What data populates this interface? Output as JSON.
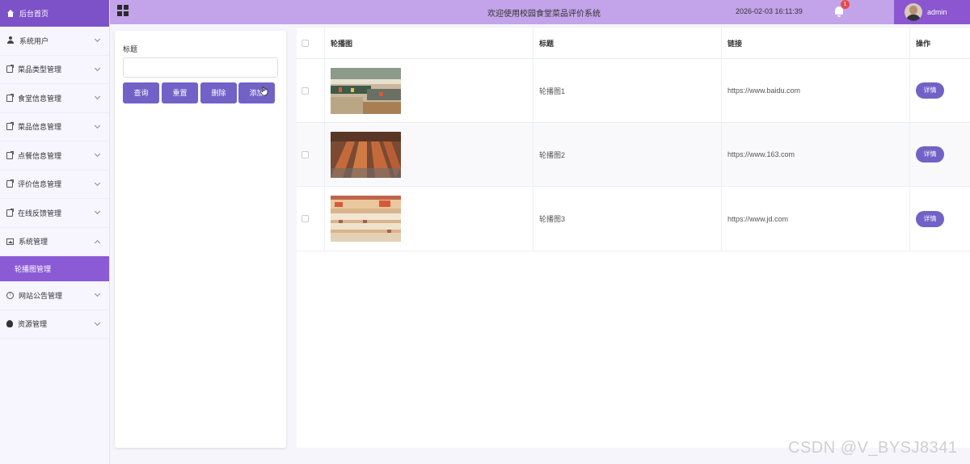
{
  "sidebar": {
    "home": "后台首页",
    "items": [
      {
        "label": "系统用户",
        "icon": "user-icon"
      },
      {
        "label": "菜品类型管理",
        "icon": "document-icon"
      },
      {
        "label": "食堂信息管理",
        "icon": "document-icon"
      },
      {
        "label": "菜品信息管理",
        "icon": "document-icon"
      },
      {
        "label": "点餐信息管理",
        "icon": "document-icon"
      },
      {
        "label": "评价信息管理",
        "icon": "document-icon"
      },
      {
        "label": "在线反馈管理",
        "icon": "document-icon"
      },
      {
        "label": "系统管理",
        "icon": "image-icon"
      }
    ],
    "active_sub": "轮播图管理",
    "items_after": [
      {
        "label": "网站公告管理",
        "icon": "info-icon"
      },
      {
        "label": "资源管理",
        "icon": "bulb-icon"
      }
    ]
  },
  "header": {
    "title": "欢迎使用校园食堂菜品评价系统",
    "time": "2026-02-03 16:11:39",
    "notification_count": "1",
    "username": "admin"
  },
  "search": {
    "label": "标题",
    "placeholder": "",
    "buttons": {
      "query": "查询",
      "reset": "重置",
      "delete": "删除",
      "add": "添加"
    }
  },
  "table": {
    "headers": {
      "image": "轮播图",
      "title": "标题",
      "link": "链接",
      "action": "操作"
    },
    "rows": [
      {
        "title": "轮播图1",
        "link": "https://www.baidu.com",
        "action": "详情",
        "image": "canteen-buffet-counter-photo"
      },
      {
        "title": "轮播图2",
        "link": "https://www.163.com",
        "action": "详情",
        "image": "canteen-dining-tables-photo"
      },
      {
        "title": "轮播图3",
        "link": "https://www.jd.com",
        "action": "详情",
        "image": "canteen-dining-hall-photo"
      }
    ]
  },
  "watermark": "CSDN @V_BYSJ8341",
  "colors": {
    "primary": "#7261c6",
    "sidebar_active": "#8b5bd6",
    "header": "#c3a3e9",
    "badge": "#e54b4b"
  }
}
